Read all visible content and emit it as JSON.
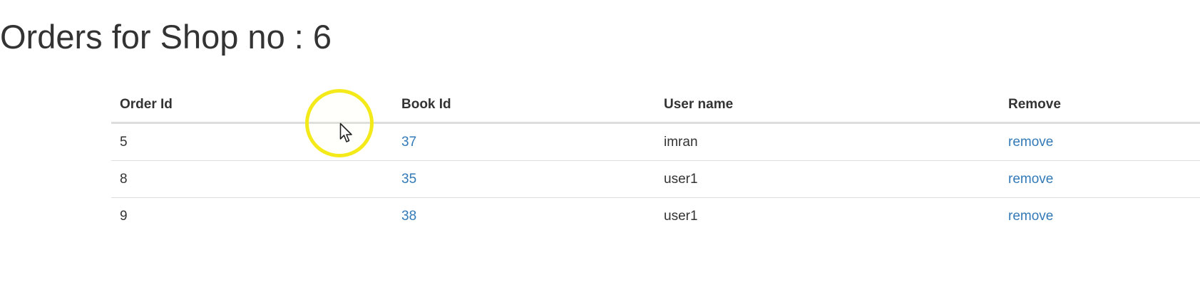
{
  "page": {
    "title": "Orders for Shop no : 6"
  },
  "table": {
    "headers": {
      "order_id": "Order Id",
      "book_id": "Book Id",
      "user_name": "User name",
      "remove": "Remove"
    },
    "rows": [
      {
        "order_id": "5",
        "book_id": "37",
        "user_name": "imran",
        "remove": "remove"
      },
      {
        "order_id": "8",
        "book_id": "35",
        "user_name": "user1",
        "remove": "remove"
      },
      {
        "order_id": "9",
        "book_id": "38",
        "user_name": "user1",
        "remove": "remove"
      }
    ]
  },
  "colors": {
    "link": "#337ab7",
    "text": "#333333",
    "cursor_highlight": "#f4ea1a"
  },
  "icons": {
    "cursor": "mouse-pointer-icon"
  }
}
